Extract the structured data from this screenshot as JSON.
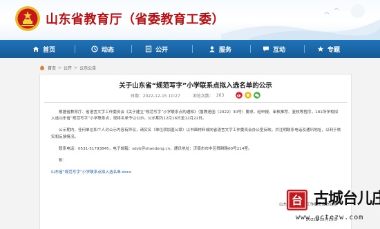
{
  "header": {
    "site_title": "山东省教育厅（省委教育工委）",
    "emblem_icon": "national-emblem-icon"
  },
  "nav": {
    "items": [
      {
        "label": "首页",
        "icon": "home-icon"
      },
      {
        "label": "动态",
        "icon": "dynamics-icon"
      },
      {
        "label": "公开",
        "icon": "public-icon"
      },
      {
        "label": "服务",
        "icon": "service-icon"
      },
      {
        "label": "互动",
        "icon": "interaction-icon"
      },
      {
        "label": "专题",
        "icon": "topic-icon"
      }
    ],
    "colors": {
      "bar": "#1b67ab",
      "text": "#ffffff"
    }
  },
  "breadcrumb": {
    "items": [
      "首页",
      "公开",
      "公示公告"
    ],
    "separator": ">"
  },
  "article": {
    "title": "关于山东省“规范写字”小学联系点拟入选名单的公示",
    "date_label": "日期：2022-12-15 10:27",
    "views_label": "浏览次数：",
    "views_value": "263",
    "share_icons": [
      "weibo-icon",
      "qzone-icon",
      "wechat-icon"
    ],
    "paragraphs": [
      "根据省教育厅、省语言文字工作委员会《关于建立“规范写字”小学联系点的通知》（鲁教语函〔2022〕30号）要求，经申报、审核推荐、复核等程序，181所学校拟入选山东省“规范写字”小学联系点，现将名单予以公示。公示期为12月16日至12月22日。",
      "公示期内，任何单位和个人对公示内容有异议，请实名（单位须加盖公章）以书面材料或向省语言文字工作委员会办公室反映，并注明联系电话及通讯地址，以利于核实和反馈情况。"
    ],
    "contact": "联系电话：0531-51793845，电子邮箱：sdyb＠shandong.cn，通讯地址：济南市市中区舜耕路60号214室。",
    "attachment_label": "附：",
    "attachment_link": "山东省“规范写字”小学联系点拟入选名单.docx",
    "signature_org": "山东省语言文字工作委员会办公室",
    "signature_date": "2022年12月15日"
  },
  "watermark": {
    "text": "古城台儿庄",
    "url": "www.gctezw.com",
    "seal_char": "台"
  }
}
